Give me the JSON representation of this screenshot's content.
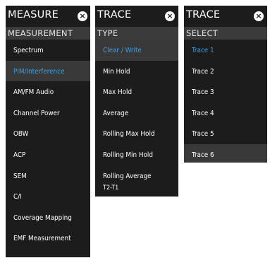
{
  "measure": {
    "title": "MEASURE",
    "section": "MEASUREMENT",
    "items": [
      "Spectrum",
      "PIM/Interference",
      "AM/FM Audio",
      "Channel Power",
      "OBW",
      "ACP",
      "SEM",
      "C/I",
      "Coverage Mapping",
      "EMF Measurement"
    ]
  },
  "trace_type": {
    "title": "TRACE",
    "section": "TYPE",
    "items": [
      "Clear / Write",
      "Min Hold",
      "Max Hold",
      "Average",
      "Rolling Max Hold",
      "Rolling Min Hold",
      "Rolling Average"
    ],
    "extra": "T2-T1"
  },
  "trace_select": {
    "title": "TRACE",
    "section": "SELECT",
    "items": [
      "Trace 1",
      "Trace 2",
      "Trace 3",
      "Trace 4",
      "Trace 5",
      "Trace 6"
    ]
  },
  "icons": {
    "close": "close-icon"
  },
  "colors": {
    "panel_bg": "#1c1c1c",
    "section_bg": "#3b3b3b",
    "highlight_bg": "#393939",
    "accent": "#3aa0e6"
  }
}
